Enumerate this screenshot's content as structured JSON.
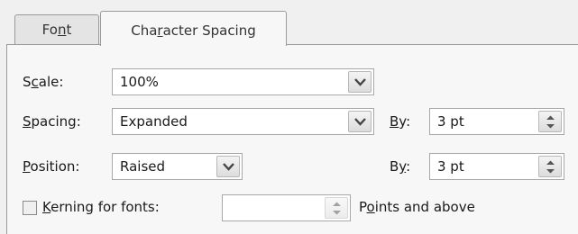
{
  "tabs": [
    {
      "label_pre": "Fo",
      "label_key": "n",
      "label_post": "t"
    },
    {
      "label_pre": "Cha",
      "label_key": "r",
      "label_post": "acter Spacing"
    }
  ],
  "scale": {
    "label_key": "c",
    "label_pre": "S",
    "label_post": "ale:",
    "value": "100%"
  },
  "spacing": {
    "label_key": "S",
    "label_pre": "",
    "label_post": "pacing:",
    "value": "Expanded",
    "by_key": "B",
    "by_post": "y:",
    "by_value": "3 pt"
  },
  "position": {
    "label_key": "P",
    "label_pre": "",
    "label_post": "osition:",
    "value": "Raised",
    "by_pre": "B",
    "by_key": "y",
    "by_post": ":",
    "by_value": "3 pt"
  },
  "kerning": {
    "checked": false,
    "label_key": "K",
    "label_post": "erning for fonts:",
    "value": "",
    "suffix_pre": "P",
    "suffix_key": "o",
    "suffix_post": "ints and above"
  },
  "icons": [
    "chevron-down-icon",
    "spin-up-down-icon"
  ]
}
